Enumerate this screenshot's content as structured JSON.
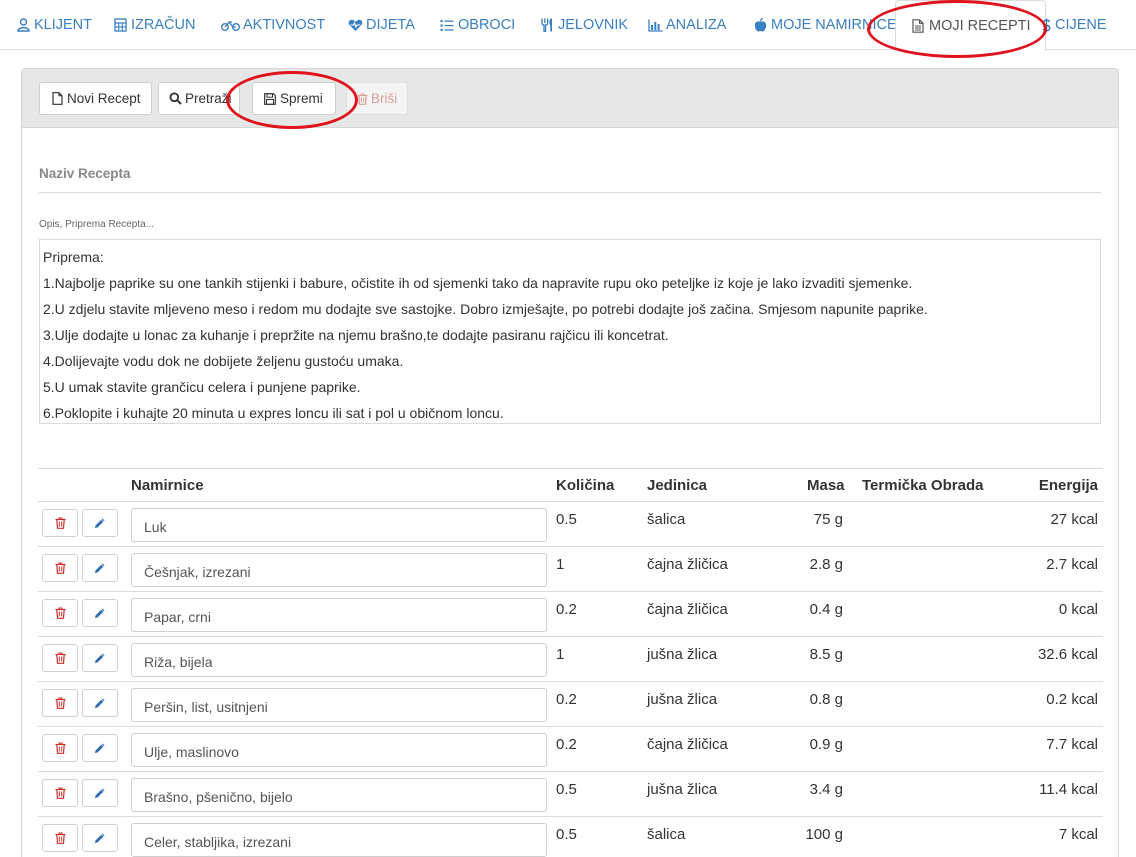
{
  "nav": {
    "items": [
      {
        "label": "KLIJENT",
        "icon": "user-icon"
      },
      {
        "label": "IZRAČUN",
        "icon": "calculator-icon"
      },
      {
        "label": "AKTIVNOST",
        "icon": "bicycle-icon"
      },
      {
        "label": "DIJETA",
        "icon": "heartbeat-icon"
      },
      {
        "label": "OBROCI",
        "icon": "list-icon"
      },
      {
        "label": "JELOVNIK",
        "icon": "cutlery-icon"
      },
      {
        "label": "ANALIZA",
        "icon": "bar-chart-icon"
      },
      {
        "label": "MOJE NAMIRNICE",
        "icon": "apple-icon"
      },
      {
        "label": "MOJI RECEPTI",
        "icon": "document-icon"
      },
      {
        "label": "CIJENE",
        "icon": "dollar-icon"
      }
    ],
    "active": "MOJI RECEPTI"
  },
  "toolbar": {
    "new_label": "Novi Recept",
    "search_label": "Pretraži",
    "save_label": "Spremi",
    "delete_label": "Briši"
  },
  "form": {
    "name_placeholder": "Naziv Recepta",
    "desc_label": "Opis, Priprema Recepta...",
    "desc_lines": [
      "Priprema:",
      "1.Najbolje paprike su one tankih stijenki i babure, očistite ih od sjemenki tako da napravite rupu oko peteljke iz koje je lako izvaditi sjemenke.",
      "2.U zdjelu stavite mljeveno meso i redom mu dodajte sve sastojke. Dobro izmješajte, po potrebi dodajte još začina. Smjesom napunite paprike.",
      "3.Ulje dodajte u lonac za kuhanje i prepržite na njemu brašno,te dodajte pasiranu rajčicu ili koncetrat.",
      "4.Dolijevajte vodu dok ne dobijete željenu gustoću umaka.",
      "5.U umak stavite grančicu celera i punjene paprike.",
      "6.Poklopite i kuhajte 20 minuta u expres loncu ili sat i pol u običnom loncu."
    ]
  },
  "table": {
    "headers": {
      "food": "Namirnice",
      "qty": "Količina",
      "unit": "Jedinica",
      "mass": "Masa",
      "thermal": "Termička Obrada",
      "energy": "Energija"
    },
    "rows": [
      {
        "food": "Luk",
        "qty": "0.5",
        "unit": "šalica",
        "mass": "75 g",
        "thermal": "",
        "energy": "27 kcal"
      },
      {
        "food": "Češnjak, izrezani",
        "qty": "1",
        "unit": "čajna žličica",
        "mass": "2.8 g",
        "thermal": "",
        "energy": "2.7 kcal"
      },
      {
        "food": "Papar, crni",
        "qty": "0.2",
        "unit": "čajna žličica",
        "mass": "0.4 g",
        "thermal": "",
        "energy": "0 kcal"
      },
      {
        "food": "Riža, bijela",
        "qty": "1",
        "unit": "jušna žlica",
        "mass": "8.5 g",
        "thermal": "",
        "energy": "32.6 kcal"
      },
      {
        "food": "Peršin, list, usitnjeni",
        "qty": "0.2",
        "unit": "jušna žlica",
        "mass": "0.8 g",
        "thermal": "",
        "energy": "0.2 kcal"
      },
      {
        "food": "Ulje, maslinovo",
        "qty": "0.2",
        "unit": "čajna žličica",
        "mass": "0.9 g",
        "thermal": "",
        "energy": "7.7 kcal"
      },
      {
        "food": "Brašno, pšenično, bijelo",
        "qty": "0.5",
        "unit": "jušna žlica",
        "mass": "3.4 g",
        "thermal": "",
        "energy": "11.4 kcal"
      },
      {
        "food": "Celer, stabljika, izrezani",
        "qty": "0.5",
        "unit": "šalica",
        "mass": "100 g",
        "thermal": "",
        "energy": "7 kcal"
      }
    ]
  },
  "colors": {
    "link": "#3a7fc1",
    "annotation": "#e0121b",
    "delete": "#c9302c"
  }
}
